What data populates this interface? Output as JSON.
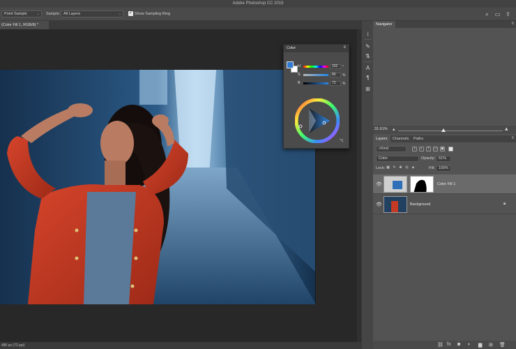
{
  "app": {
    "title": "Adobe Photoshop CC 2019"
  },
  "colors": {
    "accent": "#2f7bd3",
    "panel": "#535353",
    "selected_layer": "#6a6a6a",
    "fill_color": "#2f6fb8"
  },
  "options_bar": {
    "sample_size": "Point Sample",
    "sample_label": "Sample:",
    "sample_value": "All Layers",
    "show_ring_label": "Show Sampling Ring",
    "show_ring_checked": true,
    "right_icons": [
      "search-icon",
      "workspace-icon",
      "share-icon"
    ]
  },
  "document": {
    "tab_label": "(Color Fill 1, RGB/8) *",
    "status": "480 px (72 ppi)"
  },
  "navigator": {
    "tab": "Navigator",
    "zoom": "31.61%",
    "zoom_fraction": 0.42
  },
  "color_panel": {
    "title": "Color",
    "hsb": [
      {
        "label": "H",
        "value": "202",
        "unit": "°",
        "fraction": 0.56
      },
      {
        "label": "S",
        "value": "80",
        "unit": "%",
        "fraction": 0.8
      },
      {
        "label": "B",
        "value": "72",
        "unit": "%",
        "fraction": 0.72
      }
    ]
  },
  "layers_panel": {
    "tabs": [
      "Layers",
      "Channels",
      "Paths"
    ],
    "active_tab": "Layers",
    "filter_kind": "Kind",
    "blend_mode": "Color",
    "opacity_label": "Opacity:",
    "opacity": "61%",
    "lock_label": "Lock:",
    "fill_label": "Fill:",
    "fill": "100%",
    "layers": [
      {
        "name": "Color Fill 1",
        "selected": true,
        "visible": true
      },
      {
        "name": "Background",
        "selected": false,
        "visible": true,
        "locked": true
      }
    ]
  }
}
